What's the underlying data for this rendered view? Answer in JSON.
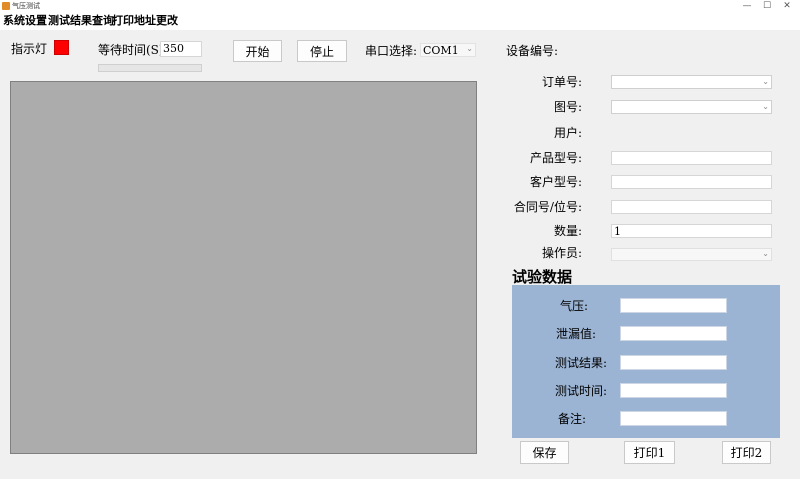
{
  "window": {
    "title": "气压测试",
    "controls": [
      "—",
      "☐",
      "✕"
    ]
  },
  "menu": [
    "系统设置",
    "测试结果查询",
    "打印地址更改"
  ],
  "toolbar": {
    "indicator_label": "指示灯",
    "indicator_color": "#ff0000",
    "wait_label": "等待时间(S)",
    "wait_value": "350",
    "progress": 0,
    "start_label": "开始",
    "stop_label": "停止",
    "port_label": "串口选择:",
    "port_value": "COM1",
    "device_label": "设备编号:"
  },
  "form": {
    "order_label": "订单号:",
    "drawing_label": "图号:",
    "user_label": "用户:",
    "product_model_label": "产品型号:",
    "customer_model_label": "客户型号:",
    "contract_label": "合同号/位号:",
    "quantity_label": "数量:",
    "quantity_value": "1",
    "operator_label": "操作员:"
  },
  "test_data": {
    "title": "试验数据",
    "panel_color": "#9bb4d4",
    "pressure_label": "气压:",
    "leak_label": "泄漏值:",
    "result_label": "测试结果:",
    "time_label": "测试时间:",
    "remark_label": "备注:"
  },
  "actions": {
    "save": "保存",
    "print1": "打印1",
    "print2": "打印2"
  },
  "icons": {
    "app": "app-icon",
    "dropdown": "chevron-down-icon"
  }
}
